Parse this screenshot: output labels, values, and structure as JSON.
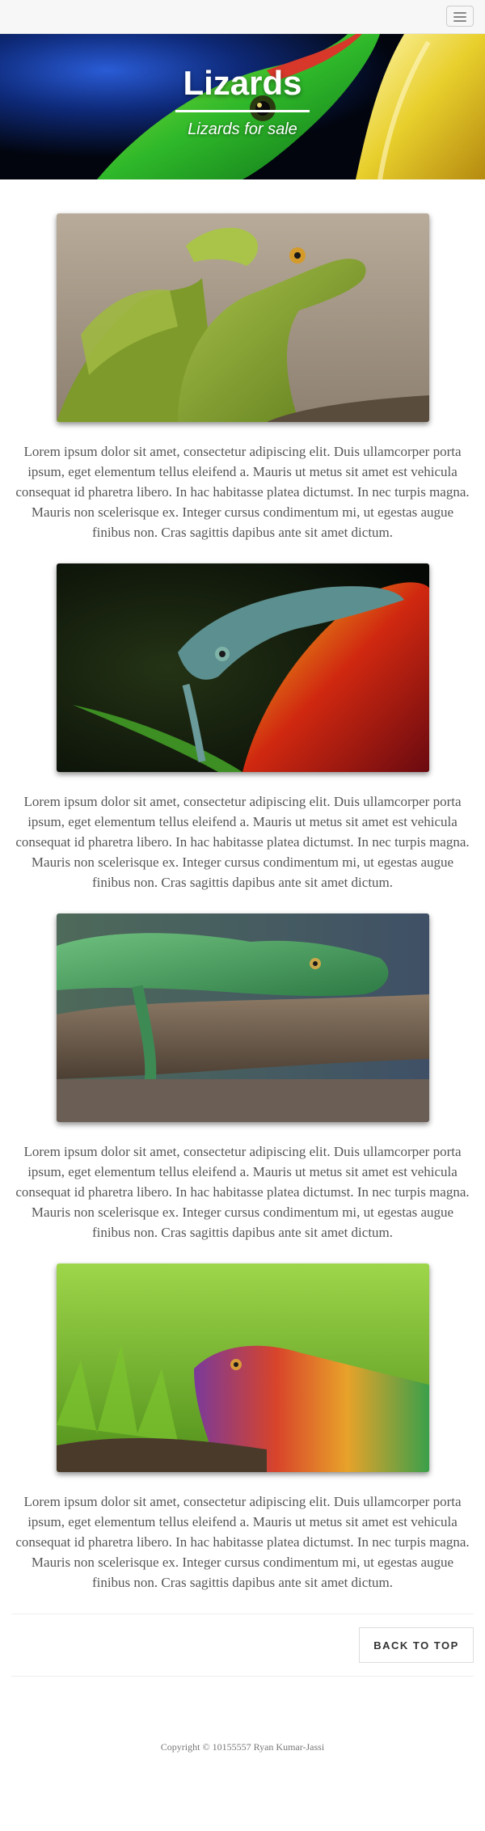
{
  "navbar": {
    "toggle_icon": "hamburger-menu-icon"
  },
  "hero": {
    "title": "Lizards",
    "subtitle": "Lizards for sale"
  },
  "sections": [
    {
      "image": "green basilisk lizard photo",
      "text": "Lorem ipsum dolor sit amet, consectetur adipiscing elit. Duis ullamcorper porta ipsum, eget elementum tellus eleifend a. Mauris ut metus sit amet est vehicula consequat id pharetra libero. In hac habitasse platea dictumst. In nec turpis magna. Mauris non scelerisque ex. Integer cursus condimentum mi, ut egestas augue finibus non. Cras sagittis dapibus ante sit amet dictum."
    },
    {
      "image": "chameleon on flower photo",
      "text": "Lorem ipsum dolor sit amet, consectetur adipiscing elit. Duis ullamcorper porta ipsum, eget elementum tellus eleifend a. Mauris ut metus sit amet est vehicula consequat id pharetra libero. In hac habitasse platea dictumst. In nec turpis magna. Mauris non scelerisque ex. Integer cursus condimentum mi, ut egestas augue finibus non. Cras sagittis dapibus ante sit amet dictum."
    },
    {
      "image": "green iguana on branch photo",
      "text": "Lorem ipsum dolor sit amet, consectetur adipiscing elit. Duis ullamcorper porta ipsum, eget elementum tellus eleifend a. Mauris ut metus sit amet est vehicula consequat id pharetra libero. In hac habitasse platea dictumst. In nec turpis magna. Mauris non scelerisque ex. Integer cursus condimentum mi, ut egestas augue finibus non. Cras sagittis dapibus ante sit amet dictum."
    },
    {
      "image": "rainbow iguana in grass photo",
      "text": "Lorem ipsum dolor sit amet, consectetur adipiscing elit. Duis ullamcorper porta ipsum, eget elementum tellus eleifend a. Mauris ut metus sit amet est vehicula consequat id pharetra libero. In hac habitasse platea dictumst. In nec turpis magna. Mauris non scelerisque ex. Integer cursus condimentum mi, ut egestas augue finibus non. Cras sagittis dapibus ante sit amet dictum."
    }
  ],
  "back_to_top_label": "BACK TO TOP",
  "footer": {
    "copyright": "Copyright © 10155557 Ryan Kumar-Jassi"
  },
  "colors": {
    "navbar_bg": "#f7f7f7",
    "body_text": "#555555",
    "hero_text": "#ffffff"
  }
}
